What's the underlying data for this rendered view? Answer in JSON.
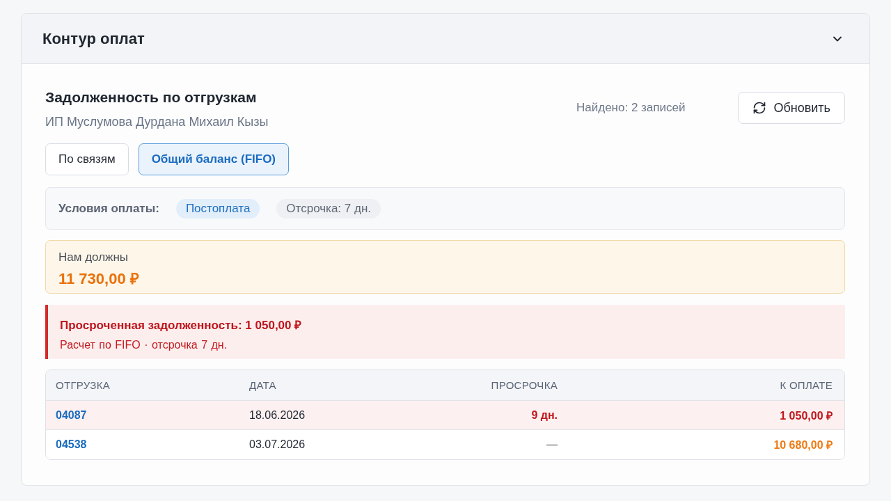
{
  "panel": {
    "title": "Контур оплат",
    "expanded": true
  },
  "header": {
    "title": "Задолженность по отгрузкам",
    "subtitle": "ИП Муслумова Дурдана Михаил Кызы",
    "found": "Найдено: 2 записей",
    "refresh_button": "Обновить"
  },
  "tabs": [
    {
      "label": "По связям",
      "selected": false
    },
    {
      "label": "Общий баланс (FIFO)",
      "selected": true
    }
  ],
  "payment_terms": {
    "label": "Условия оплаты:",
    "tags": [
      {
        "label": "Постоплата",
        "kind": "accent"
      },
      {
        "label": "Отсрочка: 7 дн.",
        "kind": "neutral"
      }
    ]
  },
  "balance": {
    "label": "Нам должны",
    "amount": "11 730,00 ₽"
  },
  "overdue_alert": {
    "title": "Просроченная задолженность: 1 050,00 ₽",
    "details": "Расчет по FIFO · отсрочка 7 дн."
  },
  "table": {
    "columns": [
      "ОТГРУЗКА",
      "ДАТА",
      "ПРОСРОЧКА",
      "К ОПЛАТЕ"
    ],
    "rows": [
      {
        "shipment": "04087",
        "date": "18.06.2026",
        "overdue_days": "9 дн.",
        "amount": "1 050,00 ₽",
        "overdue": true
      },
      {
        "shipment": "04538",
        "date": "03.07.2026",
        "overdue_days": "—",
        "amount": "10 680,00 ₽",
        "overdue": false
      }
    ]
  }
}
